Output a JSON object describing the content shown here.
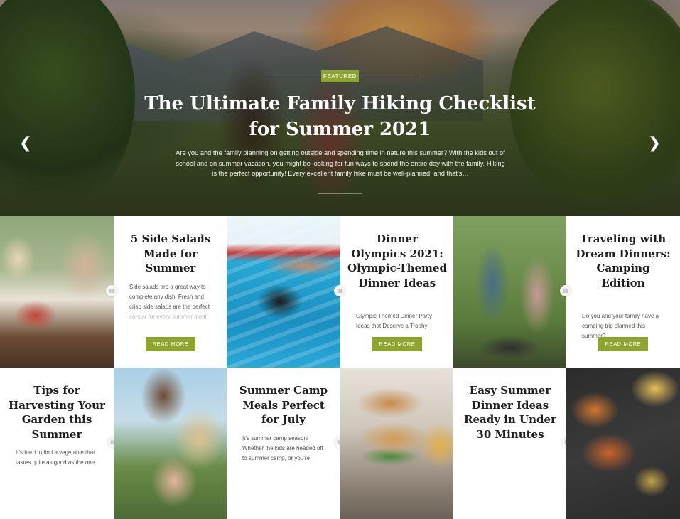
{
  "hero": {
    "badge": "FEATURED",
    "title": "The Ultimate Family Hiking Checklist for Summer 2021",
    "excerpt": "Are you and the family planning on getting outside and spending time in nature this summer? With the kids out of school and on summer vacation, you might be looking for fun ways to spend the entire day with the family. Hiking is the perfect opportunity! Every excellent family hike must be well-planned, and that's…",
    "prev_arrow": "❮",
    "next_arrow": "❯"
  },
  "icons": {
    "post": "▤"
  },
  "read_more_label": "READ MORE",
  "row1": [
    {
      "title": "5 Side Salads Made for Summer",
      "excerpt": "Side salads are a great way to complete any dish. Fresh and crisp side salads are the perfect co-star for every summer meal. What goes better with a juicy"
    },
    {
      "title": "Dinner Olympics 2021: Olympic-Themed Dinner Ideas",
      "excerpt": "Olympic Themed Dinner Party Ideas that Deserve a Trophy"
    },
    {
      "title": "Traveling with Dream Dinners: Camping Edition",
      "excerpt": "Do you and your family have a camping trip planned this summer?"
    }
  ],
  "row2": [
    {
      "title": "Tips for Harvesting Your Garden this Summer",
      "excerpt": "It's hard to find a vegetable that tastes quite as good as the one"
    },
    {
      "title": "Summer Camp Meals Perfect for July",
      "excerpt": "It's summer camp season! Whether the kids are headed off to summer camp, or you're"
    },
    {
      "title": "Easy Summer Dinner Ideas Ready in Under 30 Minutes",
      "excerpt": ""
    }
  ]
}
